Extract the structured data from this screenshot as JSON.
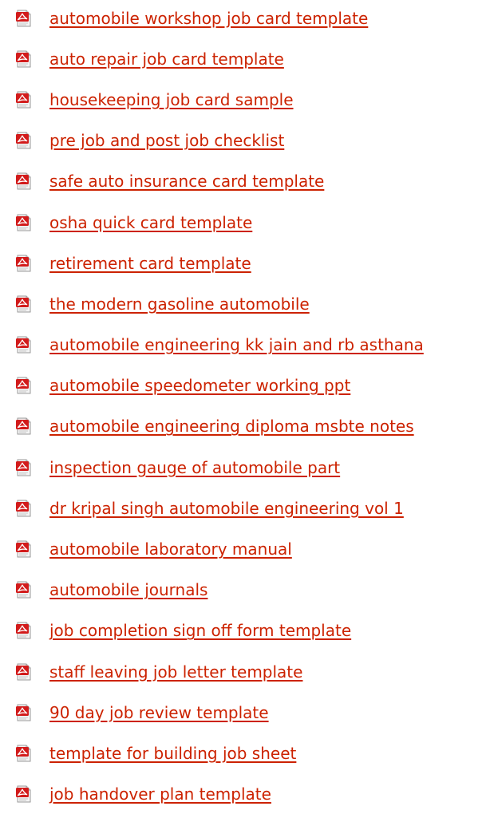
{
  "accent_color": "#cc2200",
  "icon": "pdf-file-icon",
  "links": [
    "automobile workshop job card template",
    "auto repair job card template",
    "housekeeping job card sample",
    "pre job and post job checklist",
    "safe auto insurance card template",
    "osha quick card template",
    "retirement card template",
    "the modern gasoline automobile",
    "automobile engineering kk jain and rb asthana",
    "automobile speedometer working ppt",
    "automobile engineering diploma msbte notes",
    "inspection gauge of automobile part",
    "dr kripal singh automobile engineering vol 1",
    "automobile laboratory manual",
    "automobile journals",
    "job completion sign off form template",
    "staff leaving job letter template",
    "90 day job review template",
    "template for building job sheet",
    "job handover plan template"
  ]
}
